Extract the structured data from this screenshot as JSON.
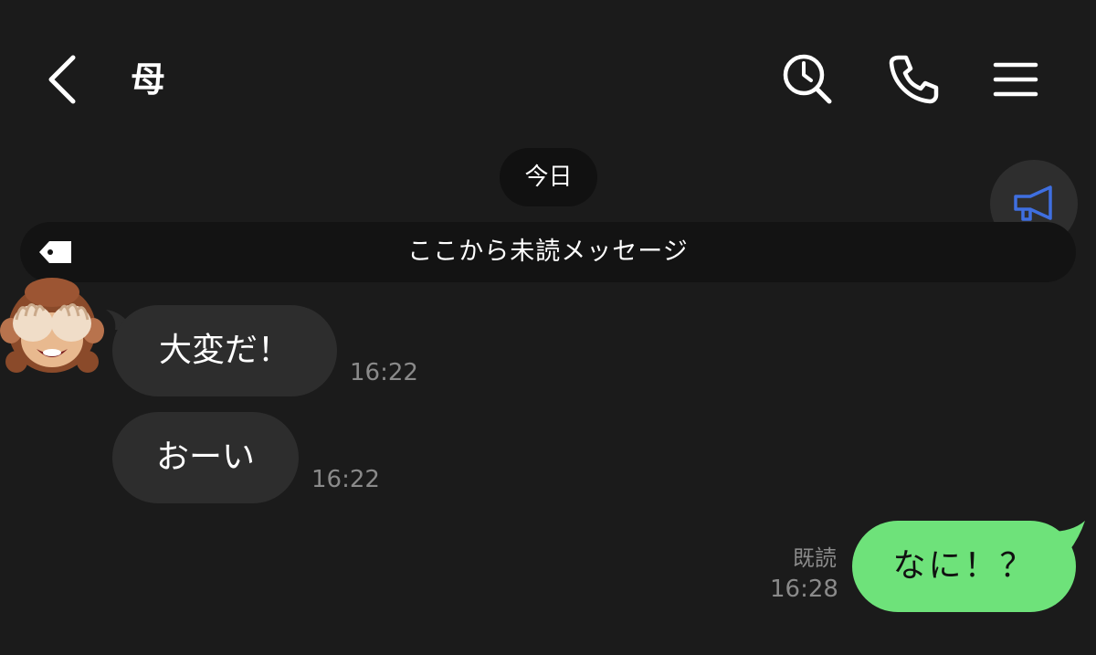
{
  "header": {
    "title": "母",
    "back_icon": "chevron-left-icon",
    "search_icon": "search-history-icon",
    "call_icon": "phone-icon",
    "menu_icon": "menu-icon"
  },
  "date_divider": "今日",
  "announcement_icon": "megaphone-icon",
  "unread_divider": {
    "icon": "tag-icon",
    "label": "ここから未読メッセージ"
  },
  "contact_avatar": "see-no-evil-monkey-emoji",
  "messages": [
    {
      "direction": "incoming",
      "text": "大変だ！",
      "time": "16:22"
    },
    {
      "direction": "incoming",
      "text": "おーい",
      "time": "16:22"
    },
    {
      "direction": "outgoing",
      "text": "なに！？",
      "time": "16:28",
      "status": "既読"
    }
  ],
  "colors": {
    "background": "#1b1b1b",
    "incoming_bubble": "#2d2d2d",
    "outgoing_bubble": "#6ee27a",
    "announce_icon": "#3f6fe0",
    "timestamp": "#8a8a8a"
  }
}
